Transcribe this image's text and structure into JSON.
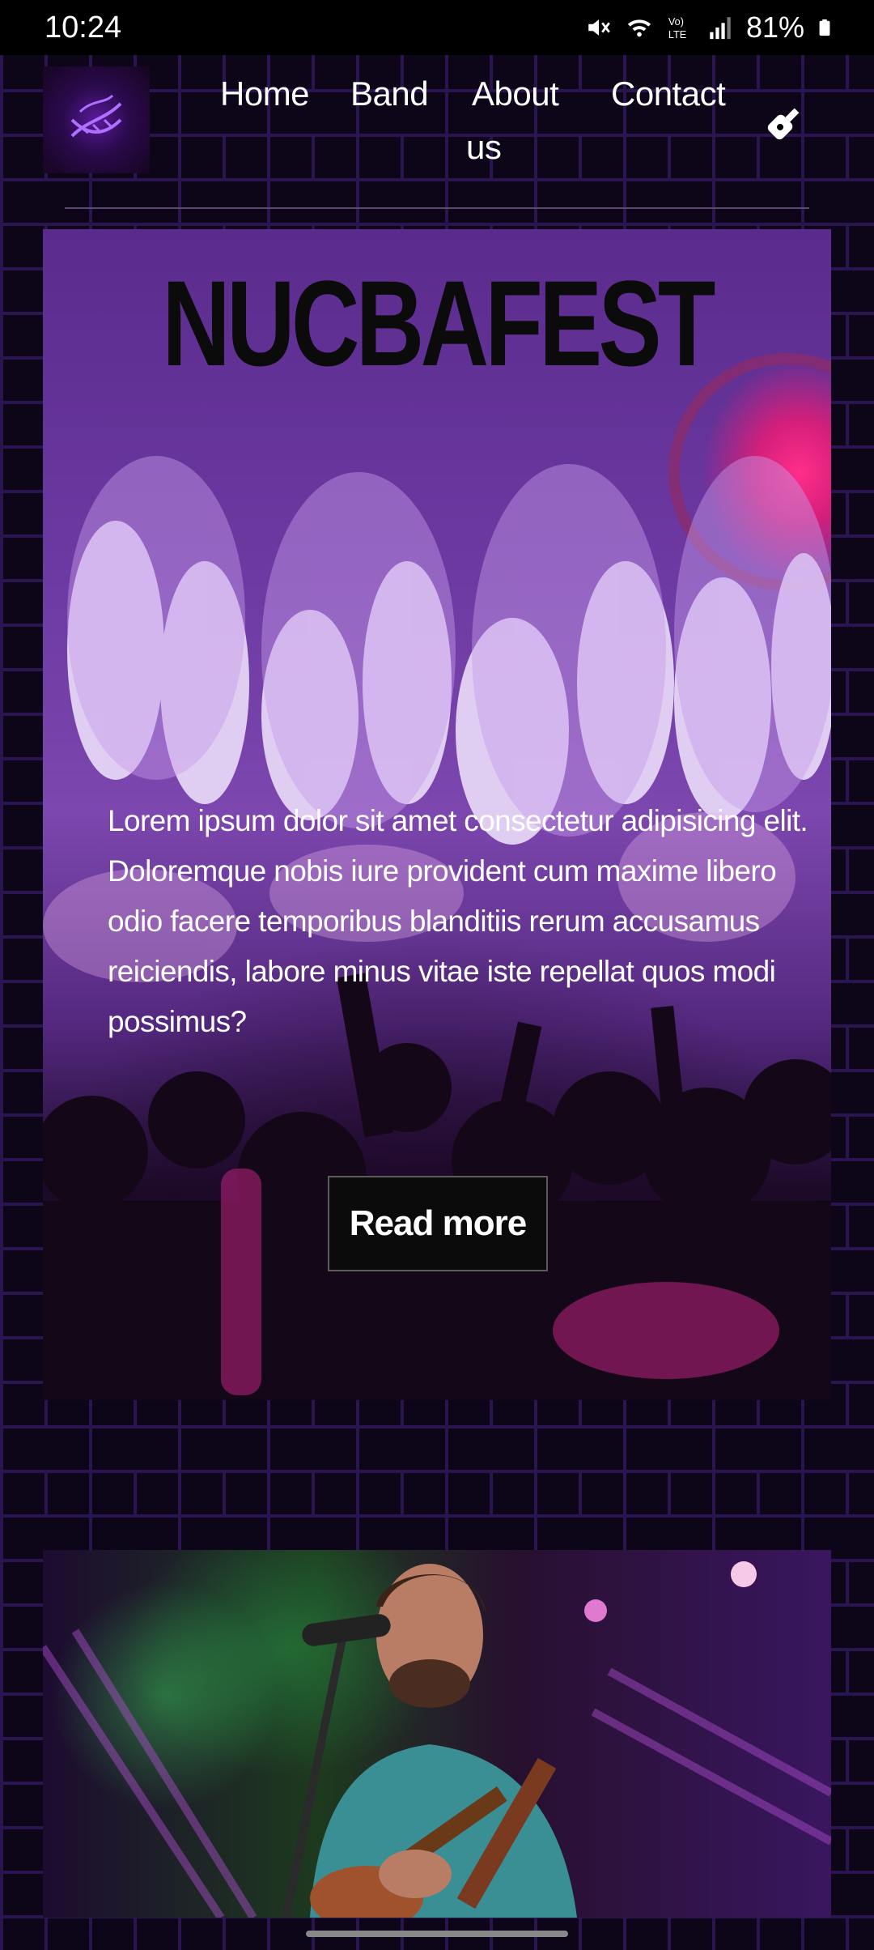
{
  "status_bar": {
    "time": "10:24",
    "battery": "81%",
    "icons": [
      "mute-icon",
      "wifi-icon",
      "volte-icon",
      "signal-icon",
      "battery-icon"
    ]
  },
  "nav": {
    "logo_icon": "dna-icon",
    "links": [
      "Home",
      "Band",
      "About",
      "us",
      "Contact"
    ],
    "cart_icon": "guitar-icon"
  },
  "hero": {
    "title": "NUCBAFEST",
    "text": "Lorem ipsum dolor sit amet consectetur adipisicing elit. Doloremque nobis iure provident cum maxime libero odio facere temporibus blanditiis rerum accusamus reiciendis, labore minus vitae iste repellat quos modi possimus?",
    "button": "Read more",
    "image": "concert-crowd-with-fireworks"
  },
  "card2": {
    "image": "singer-with-microphone-and-guitar"
  },
  "colors": {
    "background": "#0c0618",
    "brick_line": "#2a1550",
    "accent_pink": "#d51f7a",
    "accent_purple": "#6d3aa3"
  }
}
